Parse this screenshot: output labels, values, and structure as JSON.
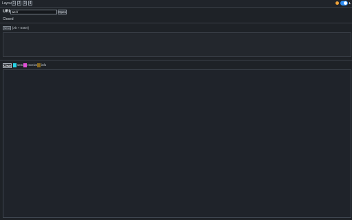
{
  "header": {
    "layout_label": "Layout",
    "layout_buttons": [
      "1",
      "2",
      "3",
      "4"
    ],
    "theme_toggle": {
      "state": "dark",
      "accent": "#2c8cf2"
    },
    "icons": [
      "sun-icon",
      "moon-icon"
    ]
  },
  "connection": {
    "url_label": "URL:",
    "url_value": "ws://",
    "open_label": "Open",
    "status": "Closed"
  },
  "composer": {
    "send_label": "Send",
    "send_hint": "[Alt + Enter]",
    "message_value": ""
  },
  "log": {
    "clear_label": "Clear",
    "legend": [
      {
        "label": "send",
        "color": "#27d3e6"
      },
      {
        "label": "receive",
        "color": "#e24fd8"
      },
      {
        "label": "info",
        "color": "#8a6a1f"
      }
    ]
  }
}
